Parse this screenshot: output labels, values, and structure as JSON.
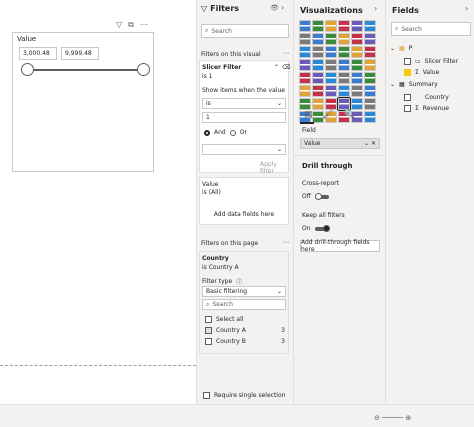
{
  "slicer": {
    "title": "Value",
    "min_value": "3,000.48",
    "max_value": "9,999.48"
  },
  "filters_pane": {
    "title": "Filters",
    "search_placeholder": "Search",
    "section_this_visual": "Filters on this visual",
    "slicer_filter": {
      "name": "Slicer Filter",
      "state": "is 1",
      "show_items_label": "Show items when the value",
      "operator": "is",
      "value": "1",
      "and_label": "And",
      "or_label": "Or",
      "apply_label": "Apply filter"
    },
    "value_filter": {
      "name": "Value",
      "state": "is (All)"
    },
    "add_fields_label": "Add data fields here",
    "section_this_page": "Filters on this page",
    "country_filter": {
      "name": "Country",
      "state": "is Country A",
      "filter_type_label": "Filter type",
      "filter_type_value": "Basic filtering",
      "search_placeholder": "Search",
      "items": [
        {
          "label": "Select all",
          "count": ""
        },
        {
          "label": "Country A",
          "count": "3"
        },
        {
          "label": "Country B",
          "count": "3"
        }
      ]
    },
    "require_single_label": "Require single selection"
  },
  "viz_pane": {
    "title": "Visualizations",
    "icon_colors": [
      "#3d7bd1",
      "#3a8a3e",
      "#e1a23a",
      "#c4314b",
      "#6b5bb8",
      "#2b88d8",
      "#7a7a7a"
    ],
    "field_label": "Field",
    "field_value": "Value",
    "drill_title": "Drill through",
    "cross_report_label": "Cross-report",
    "cross_report_state": "Off",
    "keep_filters_label": "Keep all filters",
    "keep_filters_state": "On",
    "add_drill_label": "Add drill-through fields here"
  },
  "fields_pane": {
    "title": "Fields",
    "search_placeholder": "Search",
    "tables": [
      {
        "name": "P",
        "fields": [
          "Slicer Filter",
          "Value"
        ]
      },
      {
        "name": "Summary",
        "fields": [
          "Country",
          "Revenue"
        ]
      }
    ]
  }
}
